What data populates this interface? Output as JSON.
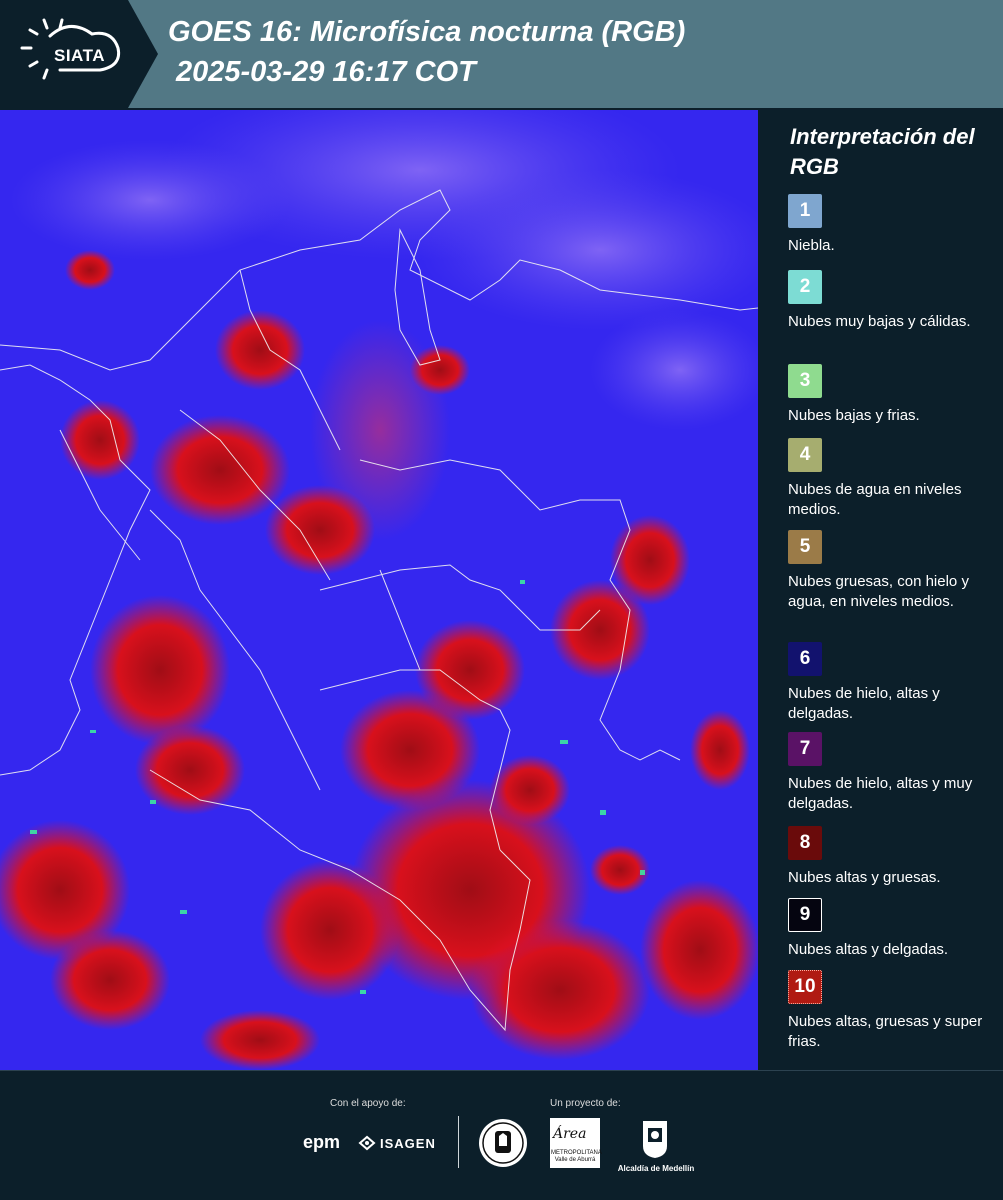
{
  "header": {
    "logo_text": "SIATA",
    "title": "GOES 16: Microfísica nocturna (RGB)",
    "subtitle": "2025-03-29 16:17 COT"
  },
  "legend": {
    "title": "Interpretación del RGB",
    "items": [
      {
        "number": "1",
        "label": "Niebla.",
        "color": "#7fa6cf"
      },
      {
        "number": "2",
        "label": "Nubes muy bajas y cálidas.",
        "color": "#7ddcd4"
      },
      {
        "number": "3",
        "label": "Nubes bajas y frias.",
        "color": "#8fdb8f"
      },
      {
        "number": "4",
        "label": "Nubes de agua en niveles medios.",
        "color": "#a6ad6f"
      },
      {
        "number": "5",
        "label": "Nubes gruesas, con hielo y agua, en niveles medios.",
        "color": "#9b7b48"
      },
      {
        "number": "6",
        "label": "Nubes de hielo, altas y delgadas.",
        "color": "#12126e"
      },
      {
        "number": "7",
        "label": "Nubes de hielo, altas y muy delgadas.",
        "color": "#5a1266"
      },
      {
        "number": "8",
        "label": "Nubes altas y gruesas.",
        "color": "#6a0b0b"
      },
      {
        "number": "9",
        "label": "Nubes altas y delgadas.",
        "color": "#050510"
      },
      {
        "number": "10",
        "label": "Nubes altas, gruesas y super frias.",
        "color": "#b01a12"
      }
    ]
  },
  "footer": {
    "support_label": "Con el apoyo de:",
    "project_label": "Un proyecto de:",
    "epm": "epm",
    "isagen": "ISAGEN",
    "area_logo": "Área",
    "area_sub": "METROPOLITANA Valle de Aburrá",
    "medellin": "Alcaldía de Medellín"
  },
  "colors": {
    "header_bg": "#527885",
    "page_bg": "#0c1f2a",
    "map_base": "#3a2af0",
    "cloud_red": "#c4121a"
  }
}
